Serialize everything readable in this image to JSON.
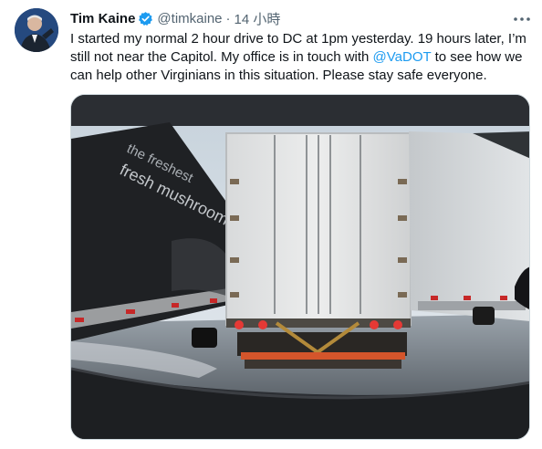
{
  "author": {
    "name": "Tim Kaine",
    "handle": "@timkaine",
    "separator": "·",
    "time": "14 小時"
  },
  "tweet": {
    "text_line1": "I started my normal 2 hour drive to DC at 1pm yesterday. 19 hours later, I’m",
    "text_line2_before": "still not near the Capitol. My office is in touch with ",
    "mention": "@VaDOT",
    "text_line2_after": " to see how we",
    "text_line3": "can help other Virginians in this situation. Please stay safe everyone."
  },
  "media": {
    "trailer_text_1": "the freshest",
    "trailer_text_2": "fresh mushrooms"
  },
  "icons": {
    "verified": "verified-badge-icon",
    "more": "more-dots-icon"
  },
  "colors": {
    "accent": "#1d9bf0",
    "text": "#0f1419",
    "secondary": "#536471"
  }
}
